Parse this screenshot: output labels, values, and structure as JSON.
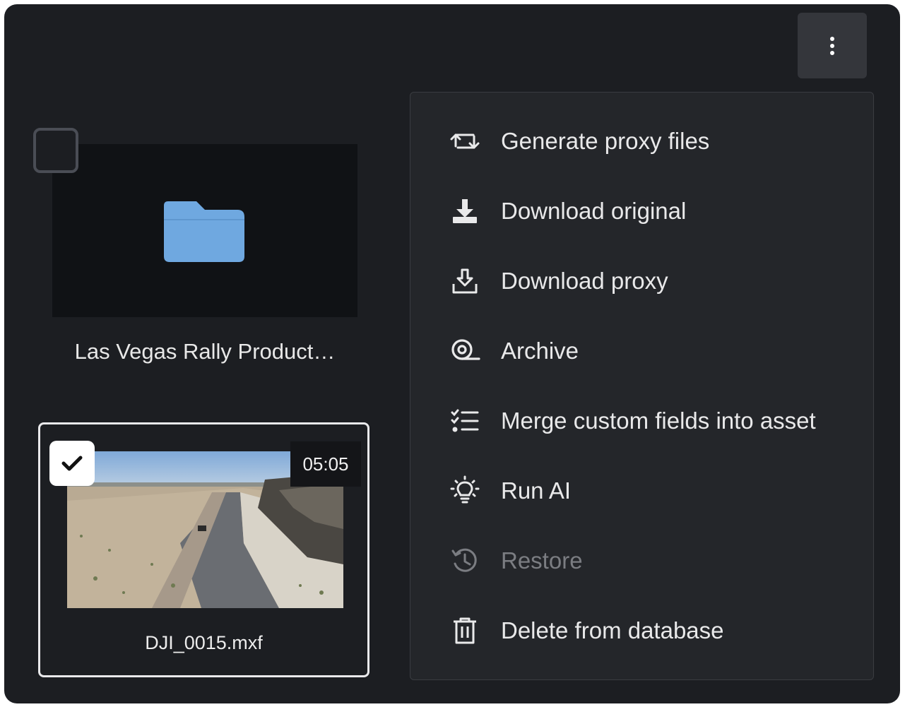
{
  "toolbar": {
    "more_icon": "kebab-vertical-icon"
  },
  "folder": {
    "name": "Las Vegas Rally Product…",
    "icon": "folder-icon",
    "color": "#6fa8e0"
  },
  "video": {
    "name": "DJI_0015.mxf",
    "duration": "05:05",
    "selected": true
  },
  "menu": {
    "items": [
      {
        "label": "Generate proxy files",
        "icon": "repeat-arrows-icon",
        "enabled": true
      },
      {
        "label": "Download original",
        "icon": "download-icon",
        "enabled": true
      },
      {
        "label": "Download proxy",
        "icon": "download-tray-icon",
        "enabled": true
      },
      {
        "label": "Archive",
        "icon": "archive-tape-icon",
        "enabled": true
      },
      {
        "label": "Merge custom fields into asset",
        "icon": "checklist-icon",
        "enabled": true
      },
      {
        "label": "Run AI",
        "icon": "lightbulb-icon",
        "enabled": true
      },
      {
        "label": "Restore",
        "icon": "history-icon",
        "enabled": false
      },
      {
        "label": "Delete from database",
        "icon": "trash-icon",
        "enabled": true
      }
    ]
  }
}
